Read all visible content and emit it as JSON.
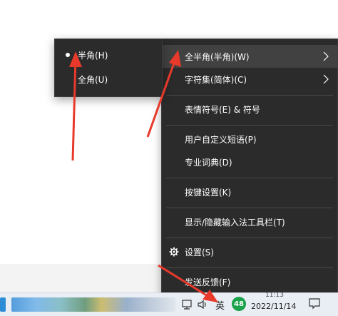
{
  "ime_menu": {
    "items": [
      {
        "label": "全半角(半角)(W)",
        "has_submenu": true,
        "highlighted": true
      },
      {
        "label": "字符集(简体)(C)",
        "has_submenu": true
      },
      {
        "label": "表情符号(E) & 符号"
      },
      {
        "label": "用户自定义短语(P)"
      },
      {
        "label": "专业词典(D)"
      },
      {
        "label": "按键设置(K)"
      },
      {
        "label": "显示/隐藏输入法工具栏(T)"
      },
      {
        "label": "设置(S)",
        "icon": "gear-icon"
      },
      {
        "label": "发送反馈(F)"
      }
    ]
  },
  "submenu": {
    "items": [
      {
        "label": "半角(H)",
        "selected": true
      },
      {
        "label": "全角(U)",
        "selected": false
      }
    ]
  },
  "taskbar": {
    "ime_indicator": "英",
    "badge_count": "48",
    "date": "2022/11/14",
    "time": "11:13"
  },
  "colors": {
    "menu_bg": "#2b2b2b",
    "highlight": "#414141",
    "annotation_arrow": "#e8392a",
    "badge": "#1aa34a"
  }
}
